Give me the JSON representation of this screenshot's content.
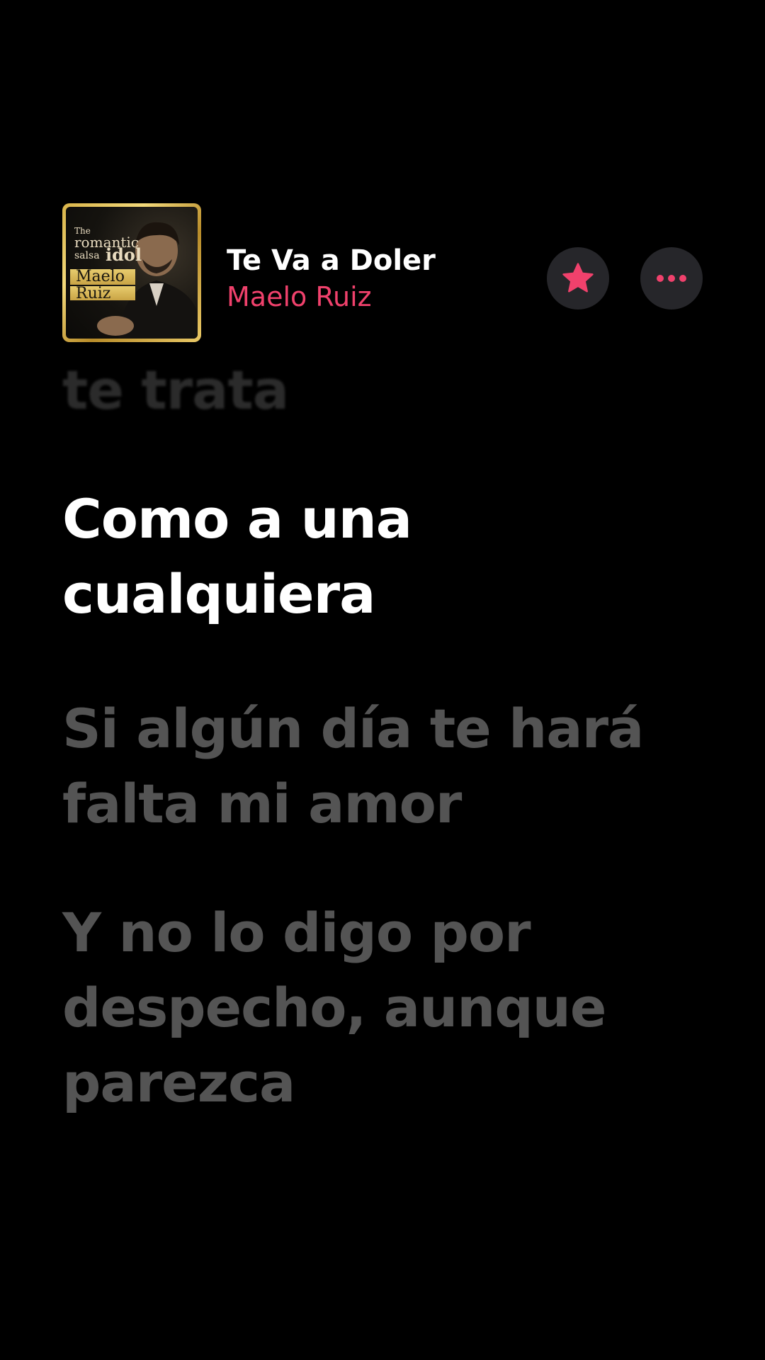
{
  "now_playing": {
    "title": "Te Va a Doler",
    "artist": "Maelo Ruiz",
    "album_art": {
      "line1": "The",
      "line2": "romantic",
      "line3": "salsa",
      "line4": "idol",
      "name_first": "Maelo",
      "name_last": "Ruiz"
    }
  },
  "controls": {
    "favorite_icon": "star-icon",
    "more_icon": "ellipsis-icon",
    "accent_color": "#f0416c"
  },
  "lyrics": {
    "previous": "te trata",
    "current": "Como a una cualquiera",
    "upcoming": [
      "Si algún día te hará falta mi amor",
      "Y no lo digo por despecho, aunque parezca"
    ]
  }
}
